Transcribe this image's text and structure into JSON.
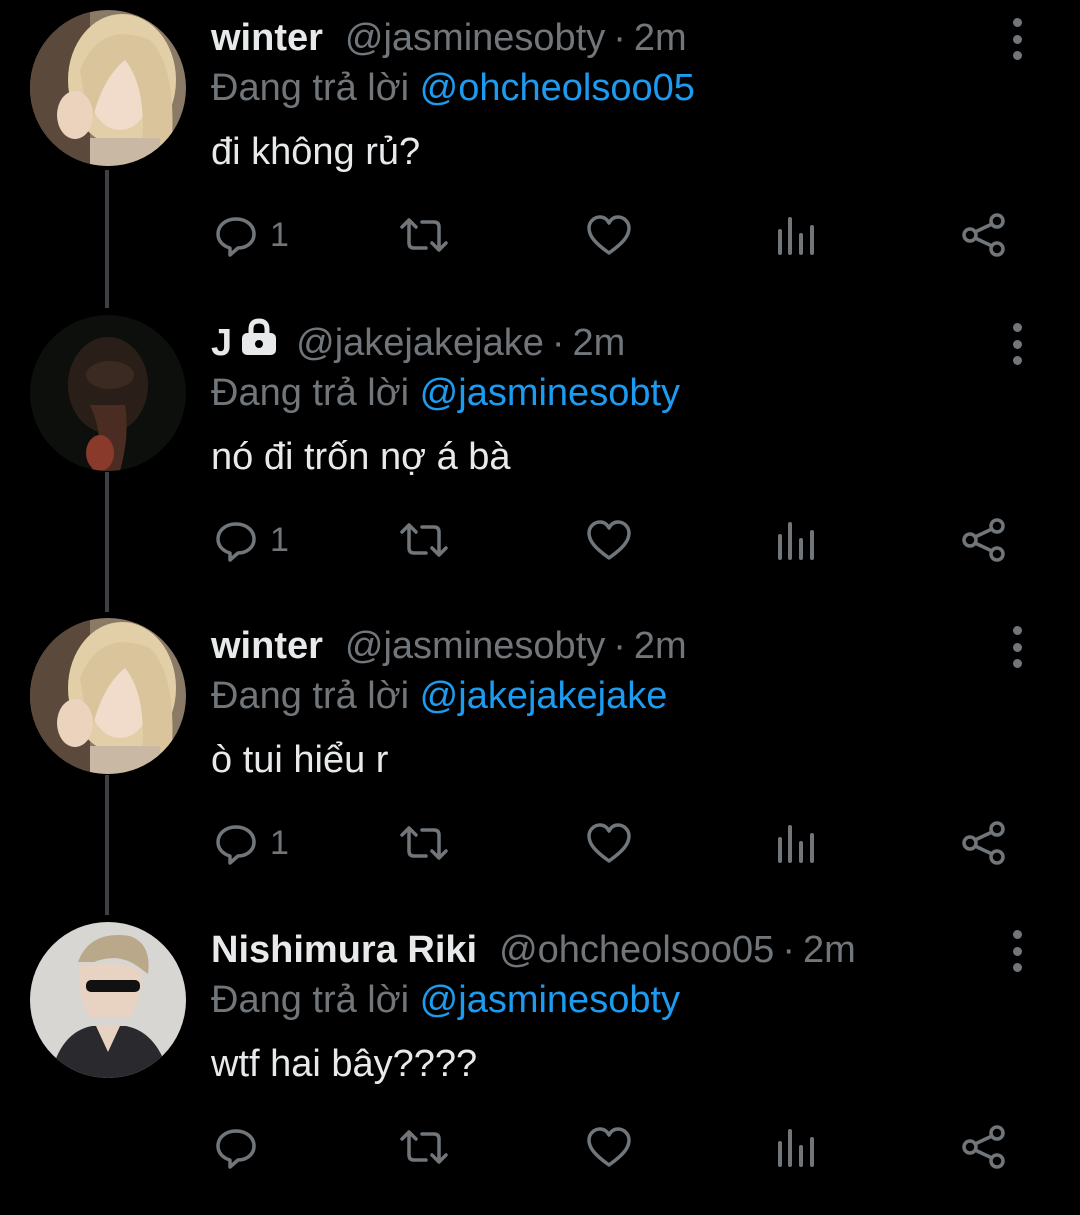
{
  "colors": {
    "background": "#000000",
    "text": "#e7e9ea",
    "muted": "#71767b",
    "accent": "#1d9bf0",
    "thread_line": "#3e4144"
  },
  "replying_prefix": "Đang trả lời",
  "tweets": [
    {
      "name": "winter",
      "protected": false,
      "handle": "@jasminesobty",
      "separator": "·",
      "time": "2m",
      "reply_to": "@ohcheolsoo05",
      "text": "đi không rủ?",
      "reply_count": "1",
      "avatar": "blonde-woman-avatar"
    },
    {
      "name": "J",
      "protected": true,
      "handle": "@jakejakejake",
      "separator": "·",
      "time": "2m",
      "reply_to": "@jasminesobty",
      "text": "nó đi trốn nợ á bà",
      "reply_count": "1",
      "avatar": "dark-man-avatar"
    },
    {
      "name": "winter",
      "protected": false,
      "handle": "@jasminesobty",
      "separator": "·",
      "time": "2m",
      "reply_to": "@jakejakejake",
      "text": "ò tui hiểu r",
      "reply_count": "1",
      "avatar": "blonde-woman-avatar"
    },
    {
      "name": "Nishimura Riki",
      "protected": false,
      "handle": "@ohcheolsoo05",
      "separator": "·",
      "time": "2m",
      "reply_to": "@jasminesobty",
      "text": "wtf hai bây????",
      "reply_count": "",
      "avatar": "sunglasses-man-avatar"
    }
  ]
}
